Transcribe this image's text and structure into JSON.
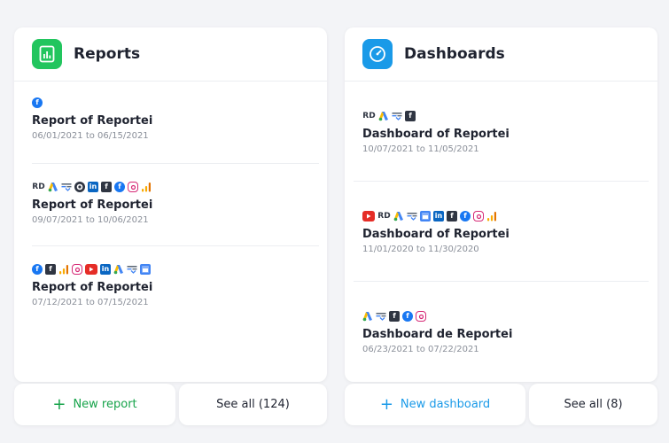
{
  "reports": {
    "title": "Reports",
    "items": [
      {
        "title": "Report of Reportei",
        "dates": "06/01/2021 to 06/15/2021",
        "icons": [
          "facebook-icon"
        ]
      },
      {
        "title": "Report of Reportei",
        "dates": "09/07/2021 to 10/06/2021",
        "icons": [
          "rd-station-icon",
          "google-ads-icon",
          "search-console-icon",
          "mailchimp-icon",
          "linkedin-icon",
          "facebook-page-icon",
          "facebook-icon",
          "instagram-icon",
          "google-analytics-icon"
        ]
      },
      {
        "title": "Report of Reportei",
        "dates": "07/12/2021 to 07/15/2021",
        "icons": [
          "facebook-icon",
          "facebook-page-icon",
          "google-analytics-icon",
          "instagram-icon",
          "youtube-icon",
          "linkedin-icon",
          "google-ads-icon",
          "search-console-icon",
          "google-my-business-icon"
        ]
      }
    ],
    "new_label": "New report",
    "see_all_label": "See all (124)"
  },
  "dashboards": {
    "title": "Dashboards",
    "items": [
      {
        "title": "Dashboard of Reportei",
        "dates": "10/07/2021 to 11/05/2021",
        "icons": [
          "rd-station-icon",
          "google-ads-icon",
          "search-console-icon",
          "facebook-page-icon"
        ]
      },
      {
        "title": "Dashboard of Reportei",
        "dates": "11/01/2020 to 11/30/2020",
        "icons": [
          "youtube-icon",
          "rd-station-icon",
          "google-ads-icon",
          "search-console-icon",
          "google-my-business-icon",
          "linkedin-icon",
          "facebook-page-icon",
          "facebook-icon",
          "instagram-icon",
          "google-analytics-icon"
        ]
      },
      {
        "title": "Dashboard de Reportei",
        "dates": "06/23/2021 to 07/22/2021",
        "icons": [
          "google-ads-icon",
          "search-console-icon",
          "facebook-page-icon",
          "facebook-icon",
          "instagram-icon"
        ]
      }
    ],
    "new_label": "New dashboard",
    "see_all_label": "See all (8)"
  },
  "colors": {
    "reports_accent": "#22c55e",
    "dashboards_accent": "#1a9ae8"
  }
}
